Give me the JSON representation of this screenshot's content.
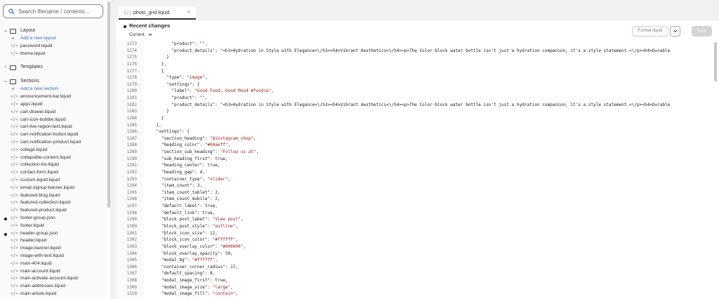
{
  "sidebar": {
    "search_placeholder": "Search filename / contents...",
    "items": [
      {
        "kind": "folder",
        "label": "Layout",
        "open": true
      },
      {
        "kind": "add",
        "label": "Add a new layout"
      },
      {
        "kind": "file",
        "label": "password.liquid"
      },
      {
        "kind": "file",
        "label": "theme.liquid"
      },
      {
        "kind": "gap"
      },
      {
        "kind": "folder",
        "label": "Templates",
        "open": false
      },
      {
        "kind": "gap"
      },
      {
        "kind": "folder",
        "label": "Sections",
        "open": true
      },
      {
        "kind": "add",
        "label": "Add a new section"
      },
      {
        "kind": "file",
        "label": "announcement-bar.liquid"
      },
      {
        "kind": "file",
        "label": "apps.liquid"
      },
      {
        "kind": "file",
        "label": "cart-drawer.liquid"
      },
      {
        "kind": "file",
        "label": "cart-icon-bubble.liquid"
      },
      {
        "kind": "file",
        "label": "cart-live-region-text.liquid"
      },
      {
        "kind": "file",
        "label": "cart-notification-button.liquid"
      },
      {
        "kind": "file",
        "label": "cart-notification-product.liquid"
      },
      {
        "kind": "file",
        "label": "collage.liquid"
      },
      {
        "kind": "file",
        "label": "collapsible-content.liquid"
      },
      {
        "kind": "file",
        "label": "collection-list.liquid"
      },
      {
        "kind": "file",
        "label": "contact-form.liquid"
      },
      {
        "kind": "file",
        "label": "custom-liquid.liquid"
      },
      {
        "kind": "file",
        "label": "email-signup-banner.liquid"
      },
      {
        "kind": "file",
        "label": "featured-blog.liquid"
      },
      {
        "kind": "file",
        "label": "featured-collection.liquid"
      },
      {
        "kind": "file",
        "label": "featured-product.liquid"
      },
      {
        "kind": "file",
        "label": "footer-group.json",
        "modified": true
      },
      {
        "kind": "file",
        "label": "footer.liquid"
      },
      {
        "kind": "file",
        "label": "header-group.json",
        "modified": true
      },
      {
        "kind": "file",
        "label": "header.liquid"
      },
      {
        "kind": "file",
        "label": "image-banner.liquid"
      },
      {
        "kind": "file",
        "label": "image-with-text.liquid"
      },
      {
        "kind": "file",
        "label": "main-404.liquid"
      },
      {
        "kind": "file",
        "label": "main-account.liquid"
      },
      {
        "kind": "file",
        "label": "main-activate-account.liquid"
      },
      {
        "kind": "file",
        "label": "main-addresses.liquid"
      },
      {
        "kind": "file",
        "label": "main-article.liquid"
      }
    ]
  },
  "icons": {
    "search": "search-icon",
    "folder": "folder-icon",
    "file": "liquid-file-icon",
    "chevron": "chevron-icon",
    "plus": "plus-icon",
    "close": "close-icon",
    "unsaved_dot": "unsaved-dot-icon"
  },
  "colors": {
    "link": "#2c6ecb",
    "string": "#a31515",
    "tab_underline": "#303030"
  },
  "editor_tab": {
    "icon_text": "{/}",
    "filename": "photo_grid.liquid",
    "close": "×"
  },
  "toolbar": {
    "recent_changes": "Recent changes",
    "current": "Current",
    "format_label": "Format liquid",
    "save_label": "Save"
  },
  "code": {
    "lines": [
      {
        "n": 1273,
        "t": "          \"product\": \"\","
      },
      {
        "n": 1274,
        "t": "          \"product_details\": \"<h3>Hydration in Style with Elegance<\\/h3><h4>Vibrant Aesthetics<\\/h4><p>The Color-block water bottle isn't just a hydration companion; it's a style statement.<\\/p><h4>Durable"
      },
      {
        "n": 1275,
        "t": "        }"
      },
      {
        "n": 1276,
        "t": "      },"
      },
      {
        "n": 1277,
        "t": "      {",
        "fold": true
      },
      {
        "n": 1278,
        "t": "        \"type\": \"image\","
      },
      {
        "n": 1279,
        "t": "        \"settings\": {",
        "fold": true
      },
      {
        "n": 1280,
        "t": "          \"label\": \"Good Food, Good Mood #foodie\","
      },
      {
        "n": 1281,
        "t": "          \"product\": \"\","
      },
      {
        "n": 1282,
        "t": "          \"product_details\": \"<h3>Hydration in Style with Elegance<\\/h3><h4>Vibrant Aesthetics<\\/h4><p>The Color-block water bottle isn't just a hydration companion; it's a style statement.<\\/p><h4>Durable"
      },
      {
        "n": 1283,
        "t": "        }"
      },
      {
        "n": 1284,
        "t": "      }"
      },
      {
        "n": 1285,
        "t": "    ],"
      },
      {
        "n": 1286,
        "t": "    \"settings\": {",
        "fold": true
      },
      {
        "n": 1287,
        "t": "      \"section_heading\": \"@instagram_shop\","
      },
      {
        "n": 1288,
        "t": "      \"heading_color\": \"#00aeff\","
      },
      {
        "n": 1289,
        "t": "      \"section_sub_heading\": \"Follow us at\","
      },
      {
        "n": 1290,
        "t": "      \"sub_heading_first\": true,"
      },
      {
        "n": 1291,
        "t": "      \"heading_center\": true,"
      },
      {
        "n": 1292,
        "t": "      \"heading_gap\": 4,"
      },
      {
        "n": 1293,
        "t": "      \"container_type\": \"slider\","
      },
      {
        "n": 1294,
        "t": "      \"item_count\": 3,"
      },
      {
        "n": 1295,
        "t": "      \"item_count_tablet\": 3,"
      },
      {
        "n": 1296,
        "t": "      \"item_count_mobile\": 2,"
      },
      {
        "n": 1297,
        "t": "      \"default_label\": true,"
      },
      {
        "n": 1298,
        "t": "      \"default_link\": true,"
      },
      {
        "n": 1299,
        "t": "      \"block_post_label\": \"View post\","
      },
      {
        "n": 1300,
        "t": "      \"block_post_style\": \"outline\","
      },
      {
        "n": 1301,
        "t": "      \"block_icon_size\": 12,"
      },
      {
        "n": 1302,
        "t": "      \"block_icon_color\": \"#ffffff\","
      },
      {
        "n": 1303,
        "t": "      \"block_overlay_color\": \"#000000\","
      },
      {
        "n": 1304,
        "t": "      \"block_overlay_opacity\": 50,"
      },
      {
        "n": 1305,
        "t": "      \"modal_bg\": \"#ffffff\","
      },
      {
        "n": 1306,
        "t": "      \"container_corner_radius\": 17,"
      },
      {
        "n": 1307,
        "t": "      \"default_spacing\": 8,"
      },
      {
        "n": 1308,
        "t": "      \"modal_image_first\": true,"
      },
      {
        "n": 1309,
        "t": "      \"modal_image_size\": \"large\","
      },
      {
        "n": 1310,
        "t": "      \"modal_image_fill\": \"contain\","
      }
    ]
  }
}
